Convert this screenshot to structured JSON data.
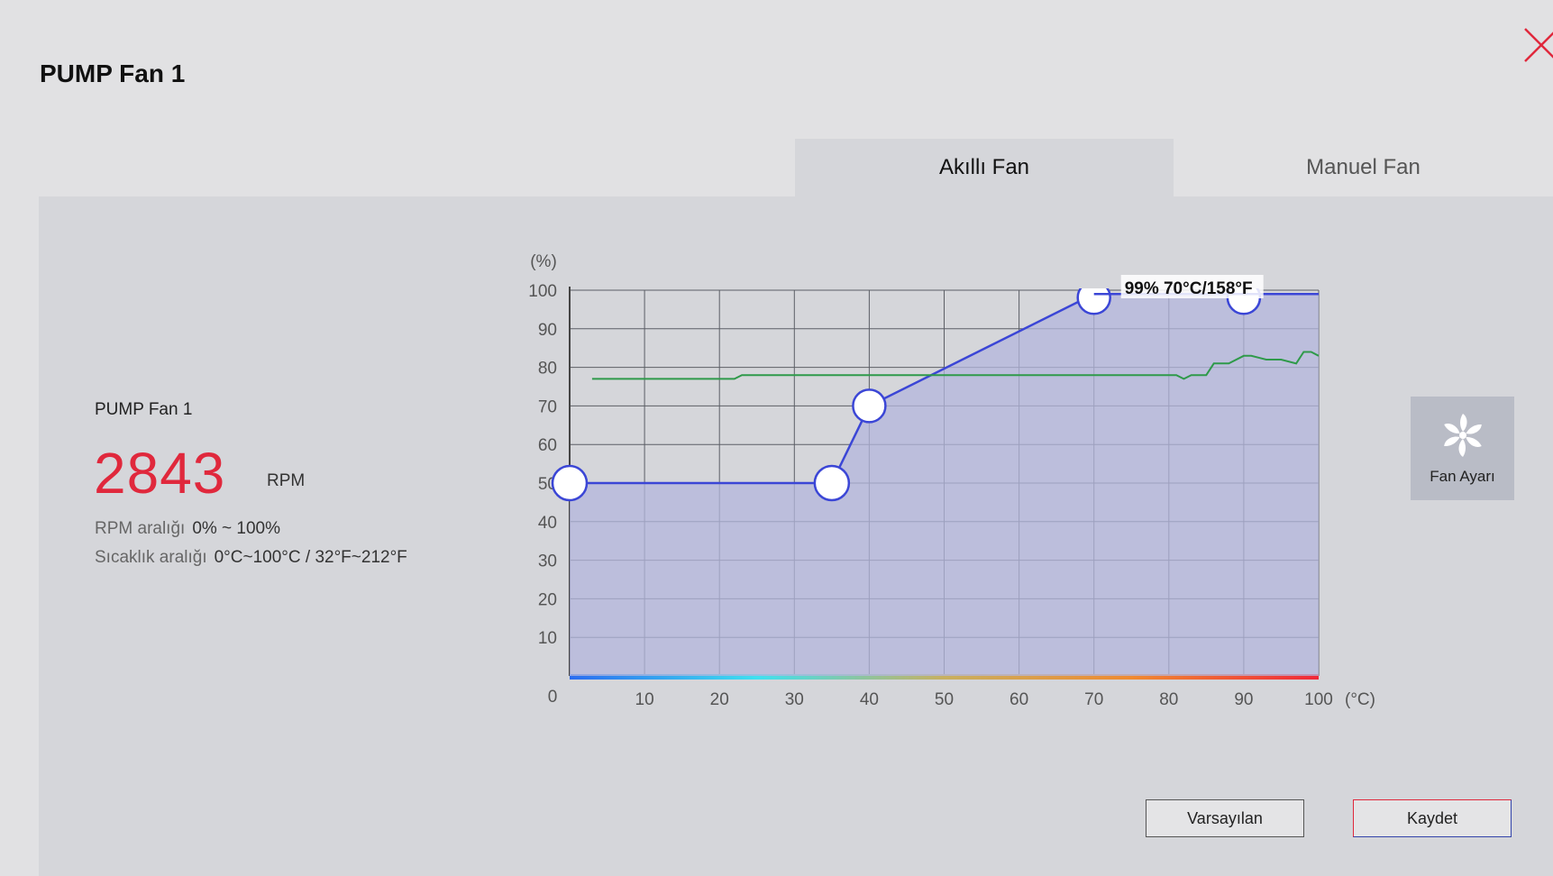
{
  "window": {
    "title": "PUMP Fan 1"
  },
  "tabs": [
    {
      "label": "Akıllı Fan",
      "active": true
    },
    {
      "label": "Manuel Fan",
      "active": false
    }
  ],
  "fan_info": {
    "name": "PUMP Fan 1",
    "rpm": "2843",
    "rpm_unit": "RPM",
    "rpm_range_label": "RPM aralığı",
    "rpm_range_value": "0% ~ 100%",
    "temp_range_label": "Sıcaklık aralığı",
    "temp_range_value": "0°C~100°C / 32°F~212°F"
  },
  "fan_settings": {
    "label": "Fan Ayarı",
    "icon": "fan-icon"
  },
  "buttons": {
    "default_label": "Varsayılan",
    "save_label": "Kaydet"
  },
  "colors": {
    "accent_red": "#e0283c",
    "curve": "#3b46d6",
    "temp_line": "#2f9a4a",
    "curve_fill": "#b3b6dc"
  },
  "chart_data": {
    "type": "line",
    "ylabel": "(%)",
    "xlabel": "(°C)",
    "xlim": [
      0,
      100
    ],
    "ylim": [
      0,
      100
    ],
    "x_ticks": [
      0,
      10,
      20,
      30,
      40,
      50,
      60,
      70,
      80,
      90,
      100
    ],
    "y_ticks": [
      10,
      20,
      30,
      40,
      50,
      60,
      70,
      80,
      90,
      100
    ],
    "series": [
      {
        "role": "fan-curve",
        "x": [
          0,
          35,
          40,
          70,
          90,
          100
        ],
        "y": [
          50,
          50,
          70,
          99,
          99,
          99
        ],
        "handles": [
          2,
          2,
          1,
          0,
          0,
          0
        ]
      },
      {
        "role": "temperature",
        "x": [
          3,
          22,
          23,
          40,
          60,
          80,
          81,
          82,
          83,
          85,
          86,
          88,
          90,
          91,
          93,
          95,
          97,
          98,
          99,
          100
        ],
        "y": [
          77,
          77,
          78,
          78,
          78,
          78,
          78,
          77,
          78,
          78,
          81,
          81,
          83,
          83,
          82,
          82,
          81,
          84,
          84,
          83
        ]
      }
    ],
    "tooltip": "99% 70°C/158°F"
  }
}
